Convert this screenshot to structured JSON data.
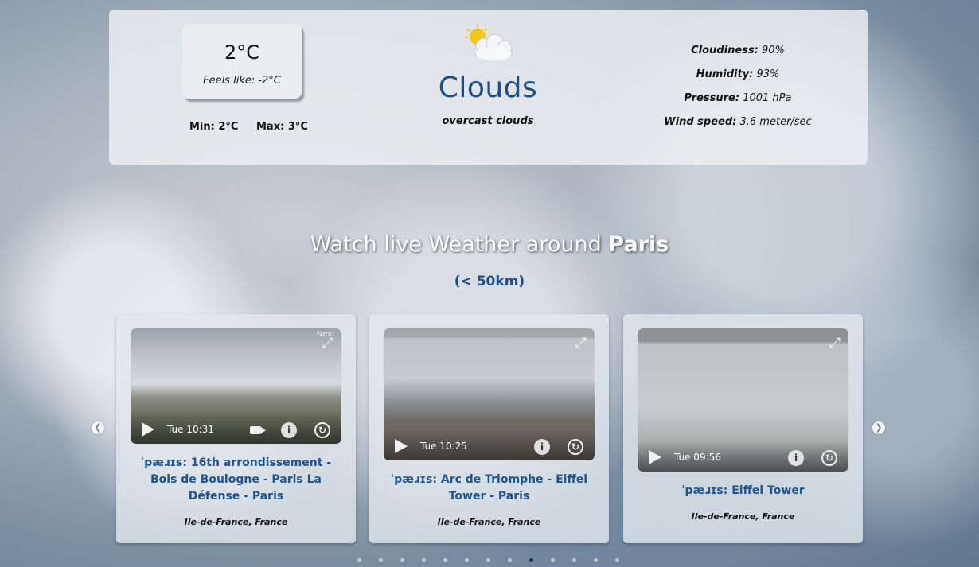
{
  "weather": {
    "temperature": "2°C",
    "feels_like": "Feels like: -2°C",
    "min": "Min: 2°C",
    "max": "Max: 3°C",
    "condition": "Clouds",
    "description": "overcast clouds",
    "icon": "partly-cloudy-icon",
    "stats": [
      {
        "label": "Cloudiness:",
        "value": "90%"
      },
      {
        "label": "Humidity:",
        "value": "93%"
      },
      {
        "label": "Pressure:",
        "value": "1001 hPa"
      },
      {
        "label": "Wind speed:",
        "value": "3.6 meter/sec"
      }
    ]
  },
  "live": {
    "title_prefix": "Watch live Weather around",
    "city": "Paris",
    "radius": "(< 50km)"
  },
  "webcams": [
    {
      "time": "Tue 10:31",
      "title": "ˈpæɹɪs: 16th arrondissement - Bois de Boulogne - Paris La Défense - Paris",
      "region": "Ile-de-France, France",
      "overlay_tag": "Next"
    },
    {
      "time": "Tue 10:25",
      "title": "ˈpæɹɪs: Arc de Triomphe - Eiffel Tower - Paris",
      "region": "Ile-de-France, France"
    },
    {
      "time": "Tue 09:56",
      "title": "ˈpæɹɪs: Eiffel Tower",
      "region": "Ile-de-France, France"
    }
  ],
  "carousel": {
    "dot_count": 13,
    "active_index": 8,
    "prev_icon": "chevron-left-icon",
    "next_icon": "chevron-right-icon"
  },
  "colors": {
    "accent": "#1d4f86",
    "link": "#1f5590"
  }
}
